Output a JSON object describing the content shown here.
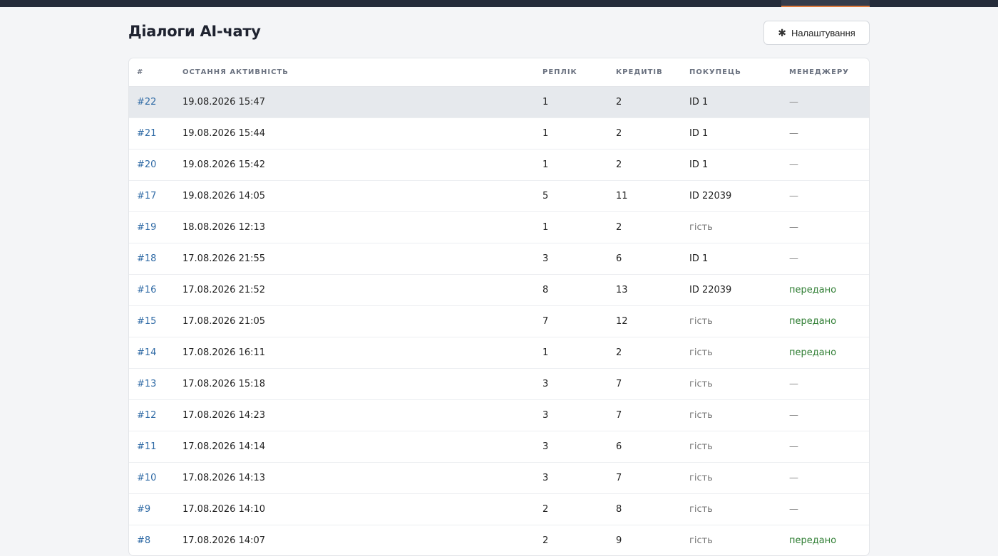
{
  "page": {
    "title": "Діалоги AI-чату",
    "settings_button": "Налаштування",
    "settings_icon": "gear-icon"
  },
  "table": {
    "columns": [
      "#",
      "ОСТАННЯ АКТИВНІСТЬ",
      "РЕПЛІК",
      "КРЕДИТІВ",
      "ПОКУПЕЦЬ",
      "МЕНЕДЖЕРУ"
    ],
    "rows": [
      {
        "id": "#22",
        "last_activity": "19.08.2026 15:47",
        "replies": "1",
        "credits": "2",
        "buyer": "ID 1",
        "manager": "—"
      },
      {
        "id": "#21",
        "last_activity": "19.08.2026 15:44",
        "replies": "1",
        "credits": "2",
        "buyer": "ID 1",
        "manager": "—"
      },
      {
        "id": "#20",
        "last_activity": "19.08.2026 15:42",
        "replies": "1",
        "credits": "2",
        "buyer": "ID 1",
        "manager": "—"
      },
      {
        "id": "#17",
        "last_activity": "19.08.2026 14:05",
        "replies": "5",
        "credits": "11",
        "buyer": "ID 22039",
        "manager": "—"
      },
      {
        "id": "#19",
        "last_activity": "18.08.2026 12:13",
        "replies": "1",
        "credits": "2",
        "buyer": "гість",
        "manager": "—"
      },
      {
        "id": "#18",
        "last_activity": "17.08.2026 21:55",
        "replies": "3",
        "credits": "6",
        "buyer": "ID 1",
        "manager": "—"
      },
      {
        "id": "#16",
        "last_activity": "17.08.2026 21:52",
        "replies": "8",
        "credits": "13",
        "buyer": "ID 22039",
        "manager": "передано"
      },
      {
        "id": "#15",
        "last_activity": "17.08.2026 21:05",
        "replies": "7",
        "credits": "12",
        "buyer": "гість",
        "manager": "передано"
      },
      {
        "id": "#14",
        "last_activity": "17.08.2026 16:11",
        "replies": "1",
        "credits": "2",
        "buyer": "гість",
        "manager": "передано"
      },
      {
        "id": "#13",
        "last_activity": "17.08.2026 15:18",
        "replies": "3",
        "credits": "7",
        "buyer": "гість",
        "manager": "—"
      },
      {
        "id": "#12",
        "last_activity": "17.08.2026 14:23",
        "replies": "3",
        "credits": "7",
        "buyer": "гість",
        "manager": "—"
      },
      {
        "id": "#11",
        "last_activity": "17.08.2026 14:14",
        "replies": "3",
        "credits": "6",
        "buyer": "гість",
        "manager": "—"
      },
      {
        "id": "#10",
        "last_activity": "17.08.2026 14:13",
        "replies": "3",
        "credits": "7",
        "buyer": "гість",
        "manager": "—"
      },
      {
        "id": "#9",
        "last_activity": "17.08.2026 14:10",
        "replies": "2",
        "credits": "8",
        "buyer": "гість",
        "manager": "—"
      },
      {
        "id": "#8",
        "last_activity": "17.08.2026 14:07",
        "replies": "2",
        "credits": "9",
        "buyer": "гість",
        "manager": "передано"
      }
    ]
  },
  "colors": {
    "link": "#2f6aa5",
    "handed_over": "#2e7d32",
    "topbar": "#252c3a",
    "active_tab_accent": "#e07b3c"
  }
}
